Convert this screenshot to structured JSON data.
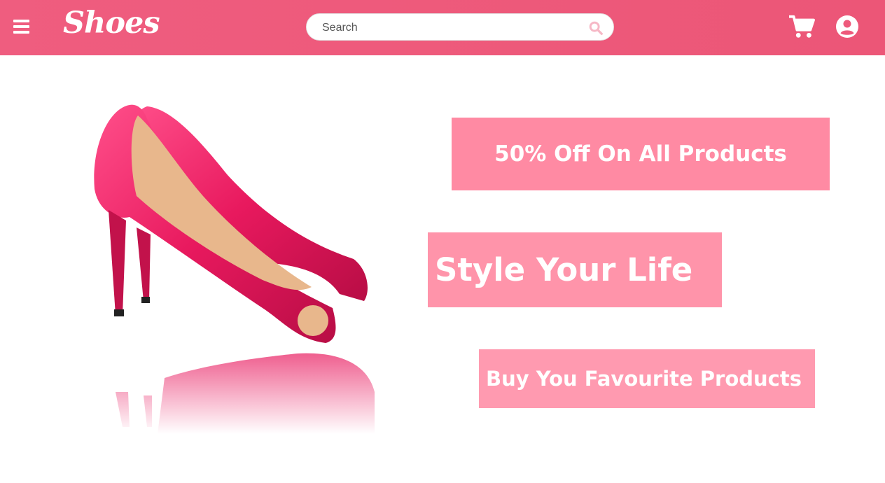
{
  "header": {
    "brand": "Shoes",
    "search": {
      "placeholder": "Search",
      "value": ""
    },
    "icons": [
      "menu-icon",
      "search-icon",
      "cart-icon",
      "user-icon"
    ]
  },
  "hero": {
    "image": "pink-high-heel-shoes",
    "promos": [
      {
        "text": "50% Off On All Products"
      },
      {
        "text": "Style Your Life"
      },
      {
        "text": "Buy You Favourite Products"
      }
    ]
  },
  "colors": {
    "navbar": "#ef5d7f",
    "promo": "#ff8aa3",
    "shoe": "#e8195e",
    "white": "#ffffff"
  }
}
